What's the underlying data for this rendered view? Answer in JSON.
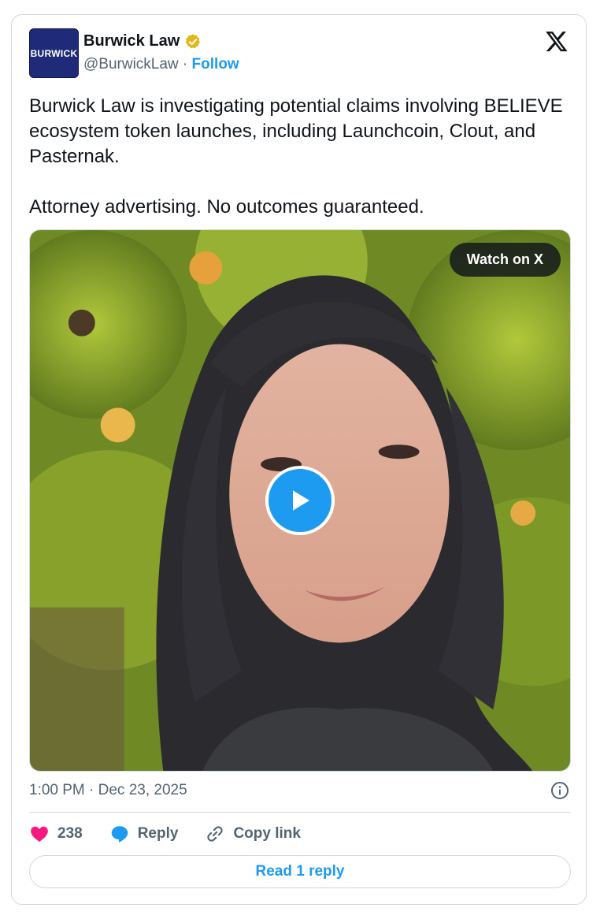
{
  "author": {
    "avatar_text": "BURWICK",
    "name": "Burwick Law",
    "handle": "@BurwickLaw",
    "separator": " · ",
    "follow_label": "Follow"
  },
  "tweet": {
    "paragraphs": [
      "Burwick Law is investigating potential claims involving BELIEVE ecosystem token launches, including Launchcoin, Clout, and Pasternak.",
      "Attorney advertising. No outcomes guaranteed."
    ],
    "timestamp": "1:00 PM · Dec 23, 2025"
  },
  "media": {
    "watch_label": "Watch on X"
  },
  "actions": {
    "likes": "238",
    "reply_label": "Reply",
    "copy_label": "Copy link",
    "read_replies_label": "Read 1 reply"
  },
  "colors": {
    "accent": "#1d9bf0",
    "like": "#f91880",
    "verified": "#e2b719"
  }
}
